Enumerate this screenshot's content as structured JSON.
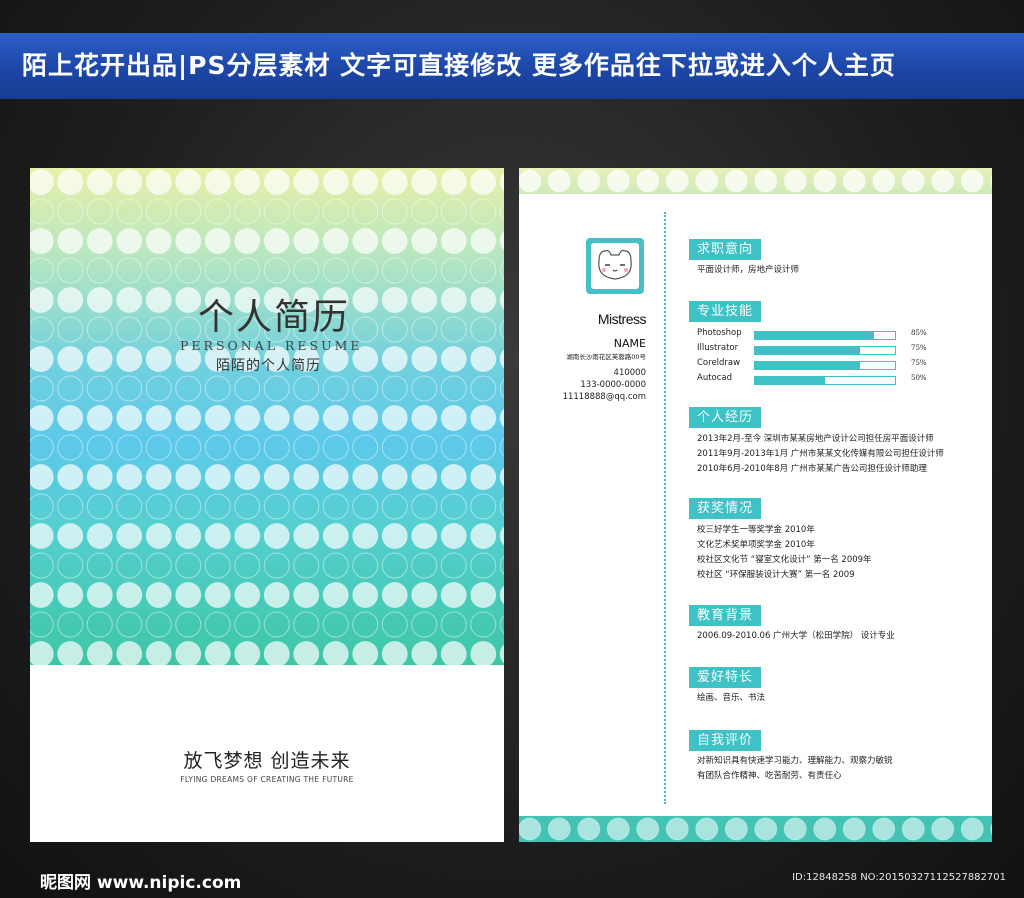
{
  "banner": {
    "text": "陌上花开出品|PS分层素材 文字可直接修改  更多作品往下拉或进入个人主页"
  },
  "cover": {
    "title": "个人简历",
    "subtitle_en": "PERSONAL RESUME",
    "subtitle_cn": "陌陌的个人简历",
    "slogan": "放飞梦想   创造未来",
    "slogan_en": "FLYING DREAMS OF CREATING THE FUTURE",
    "colors": {
      "top": "#e7f0a9",
      "middle": "#5dc9ea",
      "bottom": "#3ec6a6"
    }
  },
  "resume": {
    "name_cn": "NAME",
    "name_en": "Mistress",
    "address": "湖南长沙雨花区芙蓉路00号",
    "postcode": "410000",
    "phone": "133-0000-0000",
    "email": "11118888@qq.com",
    "accent_color": "#3ec2c6",
    "sections": {
      "objective": {
        "title": "求职意向",
        "lines": [
          "平面设计师，房地产设计师"
        ]
      },
      "skills": {
        "title": "专业技能",
        "items": [
          {
            "name": "Photoshop",
            "level": 0.85,
            "label": "85%"
          },
          {
            "name": "Illustrator",
            "level": 0.75,
            "label": "75%"
          },
          {
            "name": "Coreldraw",
            "level": 0.75,
            "label": "75%"
          },
          {
            "name": "Autocad",
            "level": 0.5,
            "label": "50%"
          }
        ]
      },
      "experience": {
        "title": "个人经历",
        "lines": [
          "2013年2月-至今  深圳市某某房地产设计公司担任房平面设计师",
          "2011年9月-2013年1月  广州市某某文化传媒有限公司担任设计师",
          "2010年6月-2010年8月  广州市某某广告公司担任设计师助理"
        ]
      },
      "awards": {
        "title": "获奖情况",
        "lines": [
          "校三好学生一等奖学金   2010年",
          "文化艺术奖单项奖学金   2010年",
          "校社区文化节 “寝室文化设计” 第一名 2009年",
          "校社区 “环保服装设计大赛” 第一名 2009"
        ]
      },
      "education": {
        "title": "教育背景",
        "lines": [
          "2006.09-2010.06 广州大学（松田学院） 设计专业"
        ]
      },
      "hobbies": {
        "title": "爱好特长",
        "lines": [
          "绘画、音乐、书法"
        ]
      },
      "evaluation": {
        "title": "自我评价",
        "lines": [
          "对新知识具有快速学习能力、理解能力、观察力敏锐",
          "有团队合作精神、吃苦耐劳、有责任心"
        ]
      }
    }
  },
  "footer": {
    "logo": "昵图网 www.nipic.com",
    "id": "ID:12848258 NO:20150327112527882701"
  }
}
